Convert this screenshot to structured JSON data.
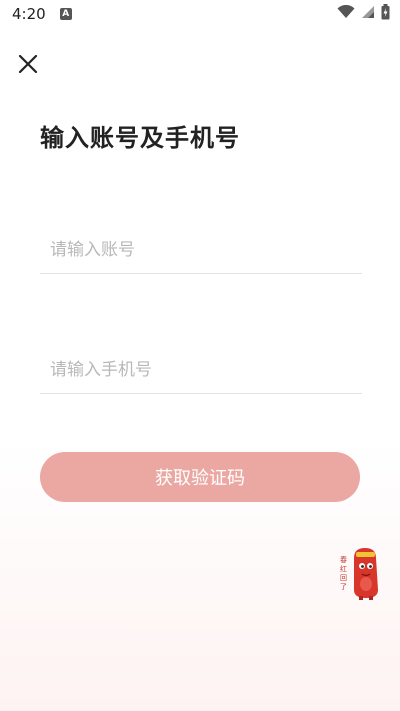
{
  "status_bar": {
    "time": "4:20",
    "notification_icon": "a-letter-icon",
    "icons": [
      "wifi-icon",
      "signal-icon",
      "battery-icon"
    ]
  },
  "header": {
    "close_icon": "close-icon"
  },
  "page": {
    "title": "输入账号及手机号"
  },
  "form": {
    "account": {
      "placeholder": "请输入账号",
      "value": ""
    },
    "phone": {
      "placeholder": "请输入手机号",
      "value": ""
    },
    "submit_label": "获取验证码"
  },
  "mascot": {
    "icon": "red-mascot-icon",
    "stamp_text": "春红回了"
  },
  "colors": {
    "button_bg": "#eba8a2",
    "placeholder": "#b8b8b8",
    "title": "#222222",
    "divider": "#e3e3e3"
  }
}
